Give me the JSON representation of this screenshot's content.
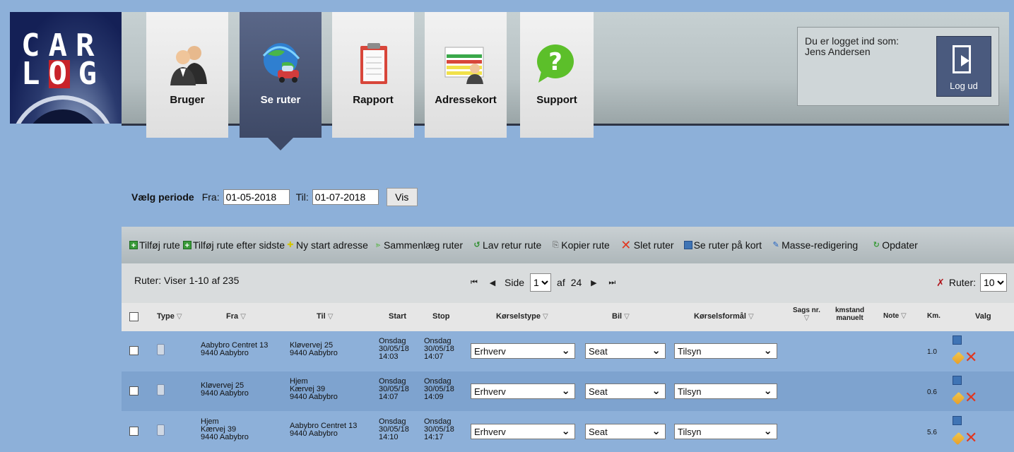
{
  "logo": {
    "line1": "CAR",
    "line2_pre": "L",
    "line2_box": "O",
    "line2_post": "G"
  },
  "tabs": [
    {
      "label": "Bruger",
      "icon": "users-icon"
    },
    {
      "label": "Se ruter",
      "icon": "globe-car-icon"
    },
    {
      "label": "Rapport",
      "icon": "clipboard-icon"
    },
    {
      "label": "Adressekort",
      "icon": "address-card-icon"
    },
    {
      "label": "Support",
      "icon": "question-bubble-icon"
    }
  ],
  "login": {
    "line1": "Du er logget ind som:",
    "line2": "Jens Andersen",
    "logout_label": "Log ud"
  },
  "period": {
    "label": "Vælg periode",
    "from_label": "Fra:",
    "from_value": "01-05-2018",
    "to_label": "Til:",
    "to_value": "01-07-2018",
    "button": "Vis"
  },
  "toolbar": {
    "add_route": "Tilføj rute",
    "add_after_last": "Tilføj rute efter sidste",
    "new_start": "Ny start adresse",
    "merge": "Sammenlæg ruter",
    "return_route": "Lav retur rute",
    "copy": "Kopier rute",
    "delete": "Slet ruter",
    "map": "Se ruter på kort",
    "mass_edit": "Masse-redigering",
    "refresh": "Opdater"
  },
  "pager": {
    "count": "Ruter: Viser 1-10 af 235",
    "page_label": "Side",
    "page_value": "1",
    "of_label": "af",
    "total_pages": "24",
    "routes_label": "Ruter:",
    "routes_value": "10"
  },
  "columns": {
    "type": "Type",
    "fra": "Fra",
    "til": "Til",
    "start": "Start",
    "stop": "Stop",
    "korselstype": "Kørselstype",
    "bil": "Bil",
    "formal": "Kørselsformål",
    "sags": "Sags nr.",
    "kmstand1": "kmstand",
    "kmstand2": "manuelt",
    "note": "Note",
    "km": "Km.",
    "valg": "Valg"
  },
  "rows": [
    {
      "fra": [
        "Aabybro Centret 13",
        "9440 Aabybro"
      ],
      "til": [
        "Kløvervej 25",
        "9440 Aabybro"
      ],
      "start": [
        "Onsdag",
        "30/05/18",
        "14:03"
      ],
      "stop": [
        "Onsdag",
        "30/05/18",
        "14:07"
      ],
      "type": "Erhverv",
      "bil": "Seat",
      "formal": "Tilsyn",
      "km": "1.0"
    },
    {
      "fra": [
        "Kløvervej 25",
        "9440 Aabybro"
      ],
      "til": [
        "Hjem",
        "Kærvej 39",
        "9440 Aabybro"
      ],
      "start": [
        "Onsdag",
        "30/05/18",
        "14:07"
      ],
      "stop": [
        "Onsdag",
        "30/05/18",
        "14:09"
      ],
      "type": "Erhverv",
      "bil": "Seat",
      "formal": "Tilsyn",
      "km": "0.6"
    },
    {
      "fra": [
        "Hjem",
        "Kærvej 39",
        "9440 Aabybro"
      ],
      "til": [
        "Aabybro Centret 13",
        "9440 Aabybro"
      ],
      "start": [
        "Onsdag",
        "30/05/18",
        "14:10"
      ],
      "stop": [
        "Onsdag",
        "30/05/18",
        "14:17"
      ],
      "type": "Erhverv",
      "bil": "Seat",
      "formal": "Tilsyn",
      "km": "5.6"
    }
  ],
  "colors": {
    "background": "#8db0d9",
    "active_tab": "#3e4966",
    "row_alt": "#7ea3cf",
    "delete_red": "#e2361f"
  }
}
